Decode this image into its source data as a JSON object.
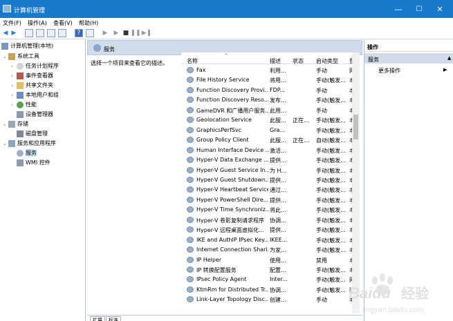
{
  "window": {
    "title": "计算机管理",
    "minimize": "—",
    "maximize": "☐",
    "close": "✕"
  },
  "menu": [
    "文件(F)",
    "操作(A)",
    "查看(V)",
    "帮助(H)"
  ],
  "tree": {
    "root": "计算机管理(本地)",
    "system_tools": "系统工具",
    "task_scheduler": "任务计划程序",
    "event_viewer": "事件查看器",
    "shared_folders": "共享文件夹",
    "local_users": "本地用户和组",
    "performance": "性能",
    "device_manager": "设备管理器",
    "storage": "存储",
    "disk_management": "磁盘管理",
    "services_apps": "服务和应用程序",
    "services": "服务",
    "wmi": "WMI 控件"
  },
  "center": {
    "title": "服务",
    "description": "选择一个项目来查看它的描述。",
    "columns": {
      "name": "名称",
      "desc": "描述",
      "status": "状态",
      "startup": "启动类型",
      "logon": "登"
    },
    "rows": [
      {
        "name": "Fax",
        "desc": "利用...",
        "status": "",
        "startup": "手动",
        "logon": "网"
      },
      {
        "name": "File History Service",
        "desc": "将用...",
        "status": "",
        "startup": "手动(触发...",
        "logon": "本"
      },
      {
        "name": "Function Discovery Provi...",
        "desc": "FDP...",
        "status": "",
        "startup": "手动",
        "logon": "本"
      },
      {
        "name": "Function Discovery Reso...",
        "desc": "发布...",
        "status": "",
        "startup": "手动(触发...",
        "logon": "本"
      },
      {
        "name": "GameDVR 和广播用户服务...",
        "desc": "此用...",
        "status": "",
        "startup": "手动",
        "logon": "本"
      },
      {
        "name": "Geolocation Service",
        "desc": "此服...",
        "status": "正在...",
        "startup": "手动(触发...",
        "logon": "本"
      },
      {
        "name": "GraphicsPerfSvc",
        "desc": "Gra...",
        "status": "",
        "startup": "手动(触发...",
        "logon": "本"
      },
      {
        "name": "Group Policy Client",
        "desc": "此服...",
        "status": "正在...",
        "startup": "自动(触发...",
        "logon": "本"
      },
      {
        "name": "Human Interface Device ...",
        "desc": "激活...",
        "status": "",
        "startup": "手动(触发...",
        "logon": "本"
      },
      {
        "name": "Hyper-V Data Exchange ...",
        "desc": "提供...",
        "status": "",
        "startup": "手动(触发...",
        "logon": "本"
      },
      {
        "name": "Hyper-V Guest Service In...",
        "desc": "为 H...",
        "status": "",
        "startup": "手动(触发...",
        "logon": "本"
      },
      {
        "name": "Hyper-V Guest Shutdown...",
        "desc": "提供...",
        "status": "",
        "startup": "手动(触发...",
        "logon": "本"
      },
      {
        "name": "Hyper-V Heartbeat Service",
        "desc": "通过...",
        "status": "",
        "startup": "手动(触发...",
        "logon": "本"
      },
      {
        "name": "Hyper-V PowerShell Dire...",
        "desc": "提供...",
        "status": "",
        "startup": "手动(触发...",
        "logon": "本"
      },
      {
        "name": "Hyper-V Time Synchroniz...",
        "desc": "将此...",
        "status": "",
        "startup": "手动(触发...",
        "logon": "本"
      },
      {
        "name": "Hyper-V 卷影复制请求程序",
        "desc": "协调...",
        "status": "",
        "startup": "手动(触发...",
        "logon": "本"
      },
      {
        "name": "Hyper-V 远程桌面虚拟化...",
        "desc": "提供...",
        "status": "",
        "startup": "手动(触发...",
        "logon": "本"
      },
      {
        "name": "IKE and AuthIP IPsec Key...",
        "desc": "IKEE...",
        "status": "",
        "startup": "手动(触发...",
        "logon": "本"
      },
      {
        "name": "Internet Connection Shari...",
        "desc": "为家...",
        "status": "",
        "startup": "手动(触发...",
        "logon": "本"
      },
      {
        "name": "IP Helper",
        "desc": "使用...",
        "status": "",
        "startup": "禁用",
        "logon": "本"
      },
      {
        "name": "IP 转换配置服务",
        "desc": "配置...",
        "status": "",
        "startup": "手动(触发...",
        "logon": "本"
      },
      {
        "name": "IPsec Policy Agent",
        "desc": "Inter...",
        "status": "",
        "startup": "手动(触发...",
        "logon": "网"
      },
      {
        "name": "KtmRm for Distributed Tr...",
        "desc": "协调...",
        "status": "",
        "startup": "手动(触发...",
        "logon": "网"
      },
      {
        "name": "Link-Layer Topology Disc...",
        "desc": "创建...",
        "status": "",
        "startup": "手动",
        "logon": "本"
      }
    ],
    "tabs": [
      "扩展",
      "标准"
    ]
  },
  "actions": {
    "header": "操作",
    "section": "服务",
    "more": "更多操作"
  },
  "watermark": {
    "text1": "Baidu",
    "text2": "经验",
    "url": "jingyan.baidu.com"
  },
  "colors": {
    "titlebar": "#1979ca",
    "pane_header": "#d1dceb",
    "selection": "#cde8ff"
  }
}
